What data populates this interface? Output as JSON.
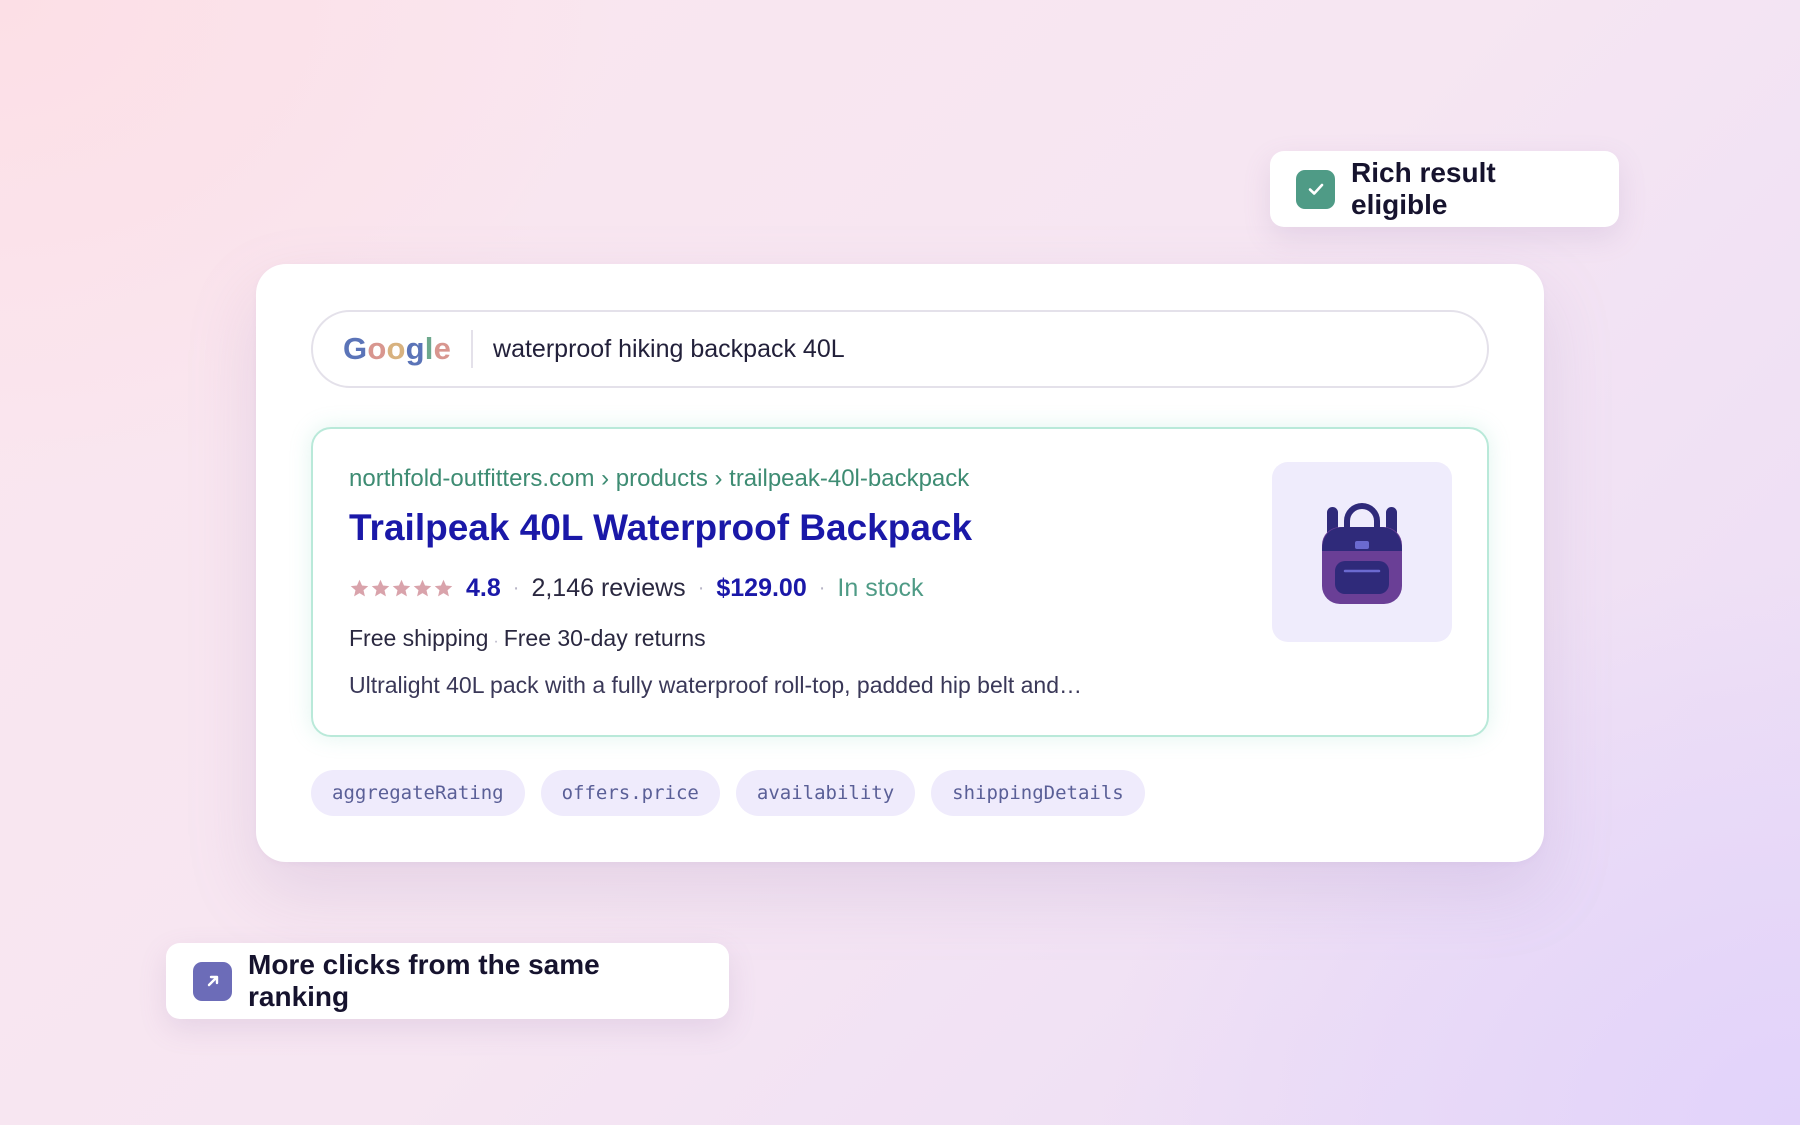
{
  "badges": {
    "eligible": {
      "icon": "check-icon",
      "label": "Rich result eligible",
      "color": "#4f9b86"
    },
    "clicks": {
      "icon": "arrow-up-right-icon",
      "label": "More clicks from the same ranking",
      "color": "#6c6cb8"
    }
  },
  "search": {
    "logo": [
      "G",
      "o",
      "o",
      "g",
      "l",
      "e"
    ],
    "query": "waterproof hiking backpack 40L"
  },
  "result": {
    "breadcrumb": "northfold-outfitters.com › products › trailpeak-40l-backpack",
    "title": "Trailpeak 40L Waterproof Backpack",
    "rating_stars": 5,
    "rating": "4.8",
    "reviews": "2,146 reviews",
    "price": "$129.00",
    "stock": "In stock",
    "shipping": "Free shipping",
    "returns": "Free 30-day returns",
    "description": "Ultralight 40L pack with a fully waterproof roll-top, padded hip belt and…",
    "thumbnail_icon": "backpack-icon"
  },
  "schema_chips": [
    "aggregateRating",
    "offers.price",
    "availability",
    "shippingDetails"
  ],
  "colors": {
    "title_blue": "#1a18a8",
    "url_green": "#3e8c73",
    "star_pink": "#d9a3ab",
    "chip_bg": "#efebfc"
  }
}
